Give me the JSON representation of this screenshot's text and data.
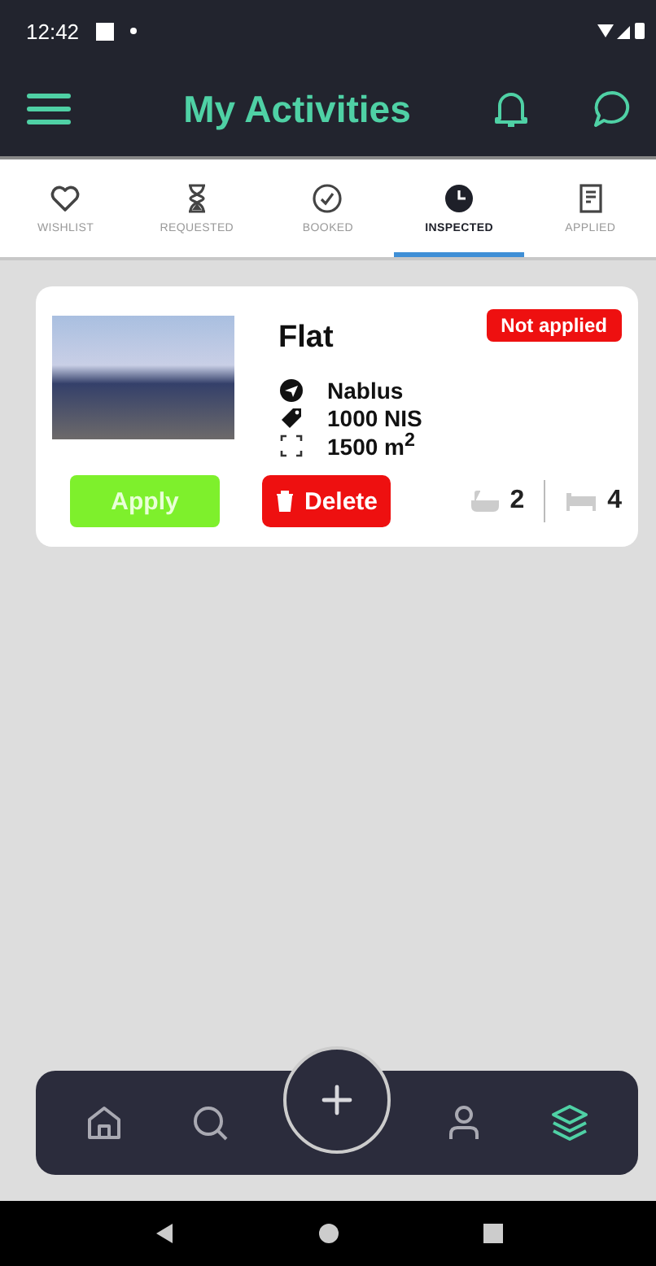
{
  "status_bar": {
    "time": "12:42"
  },
  "app_bar": {
    "title": "My Activities"
  },
  "tabs": [
    {
      "label": "WISHLIST",
      "selected": false
    },
    {
      "label": "REQUESTED",
      "selected": false
    },
    {
      "label": "BOOKED",
      "selected": false
    },
    {
      "label": "INSPECTED",
      "selected": true
    },
    {
      "label": "APPLIED",
      "selected": false
    }
  ],
  "listings": [
    {
      "title": "Flat",
      "badge": "Not applied",
      "details": [
        {
          "kind": "location",
          "text": "Nablus"
        },
        {
          "kind": "price",
          "text": "1000 NIS"
        },
        {
          "kind": "area",
          "text": "1500 m$^{2}$"
        }
      ],
      "apply": "Apply",
      "delete": "Delete",
      "bathrooms": "2",
      "bedrooms": "4"
    }
  ],
  "bottom_nav": [
    {
      "selected": false
    },
    {
      "selected": false
    },
    {
      "selected": false
    },
    {
      "selected": false
    },
    {
      "selected": true
    }
  ]
}
